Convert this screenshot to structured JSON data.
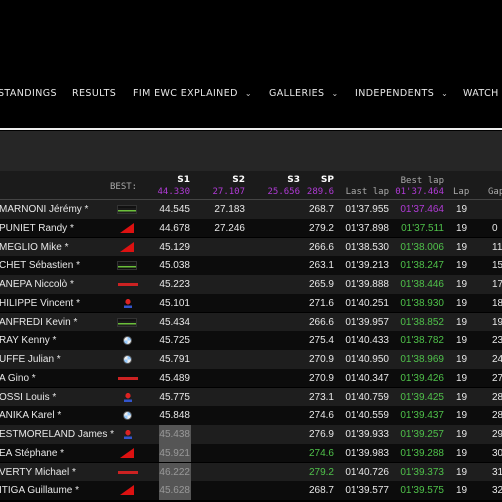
{
  "nav": [
    {
      "label": "STANDINGS",
      "chevron": false
    },
    {
      "label": "RESULTS",
      "chevron": false
    },
    {
      "label": "FIM EWC EXPLAINED",
      "chevron": true
    },
    {
      "label": "GALLERIES",
      "chevron": true
    },
    {
      "label": "INDEPENDENTS",
      "chevron": true
    },
    {
      "label": "WATCH",
      "chevron": false
    }
  ],
  "table": {
    "headers": {
      "best": "BEST:",
      "s1": "S1",
      "s2": "S2",
      "s3": "S3",
      "sp": "SP",
      "last_lap": "Last lap",
      "best_lap": "Best lap",
      "lap": "Lap",
      "gap": "Gap"
    },
    "best": {
      "s1": "44.330",
      "s2": "27.107",
      "s3": "25.656",
      "sp": "289.6",
      "best_lap": "01'37.464"
    },
    "colors": {
      "purple": "#b03ad6",
      "green": "#4fc14a",
      "row_odd": "#1e1e1e",
      "row_even": "#0c0c0c"
    },
    "rows": [
      {
        "name": "MARNONI Jérémy *",
        "brand": "kawasaki",
        "s1": "44.545",
        "s2": "27.183",
        "sp": "268.7",
        "last": "01'37.955",
        "best": "01'37.464",
        "best_color": "purple",
        "lap": "19",
        "gap": ""
      },
      {
        "name": "PUNIET Randy *",
        "brand": "honda",
        "s1": "44.678",
        "s2": "27.246",
        "sp": "279.2",
        "last": "01'37.898",
        "best": "01'37.511",
        "best_color": "green",
        "lap": "19",
        "gap": "0"
      },
      {
        "name": "MEGLIO Mike *",
        "brand": "honda",
        "s1": "45.129",
        "s2": "",
        "sp": "266.6",
        "last": "01'38.530",
        "best": "01'38.006",
        "best_color": "green",
        "lap": "19",
        "gap": "11"
      },
      {
        "name": "CHET Sébastien *",
        "brand": "kawasaki",
        "s1": "45.038",
        "s2": "",
        "sp": "263.1",
        "last": "01'39.213",
        "best": "01'38.247",
        "best_color": "green",
        "lap": "19",
        "gap": "15"
      },
      {
        "name": "ANEPA Niccolò *",
        "brand": "yamaha",
        "s1": "45.223",
        "s2": "",
        "sp": "265.9",
        "last": "01'39.888",
        "best": "01'38.446",
        "best_color": "green",
        "lap": "19",
        "gap": "17"
      },
      {
        "name": "HILIPPE Vincent *",
        "brand": "suzuki",
        "s1": "45.101",
        "s2": "",
        "sp": "271.6",
        "last": "01'40.251",
        "best": "01'38.930",
        "best_color": "green",
        "lap": "19",
        "gap": "18"
      },
      {
        "name": "ANFREDI Kevin *",
        "brand": "kawasaki",
        "s1": "45.434",
        "s2": "",
        "sp": "266.6",
        "last": "01'39.957",
        "best": "01'38.852",
        "best_color": "green",
        "lap": "19",
        "gap": "19"
      },
      {
        "name": "RAY Kenny *",
        "brand": "bmw",
        "s1": "45.725",
        "s2": "",
        "sp": "275.4",
        "last": "01'40.433",
        "best": "01'38.782",
        "best_color": "green",
        "lap": "19",
        "gap": "23"
      },
      {
        "name": "UFFE Julian *",
        "brand": "bmw",
        "s1": "45.791",
        "s2": "",
        "sp": "270.9",
        "last": "01'40.950",
        "best": "01'38.969",
        "best_color": "green",
        "lap": "19",
        "gap": "24"
      },
      {
        "name": "A Gino *",
        "brand": "yamaha",
        "s1": "45.489",
        "s2": "",
        "sp": "270.9",
        "last": "01'40.347",
        "best": "01'39.426",
        "best_color": "green",
        "lap": "19",
        "gap": "27"
      },
      {
        "name": "OSSI Louis *",
        "brand": "suzuki",
        "s1": "45.775",
        "s2": "",
        "sp": "273.1",
        "last": "01'40.759",
        "best": "01'39.425",
        "best_color": "green",
        "lap": "19",
        "gap": "28"
      },
      {
        "name": "ANIKA Karel *",
        "brand": "bmw",
        "s1": "45.848",
        "s2": "",
        "sp": "274.6",
        "last": "01'40.559",
        "best": "01'39.437",
        "best_color": "green",
        "lap": "19",
        "gap": "28"
      },
      {
        "name": "ESTMORELAND James *",
        "brand": "suzuki",
        "s1": "45.438",
        "s1_gray": true,
        "s2": "",
        "sp": "276.9",
        "last": "01'39.933",
        "best": "01'39.257",
        "best_color": "green",
        "lap": "19",
        "gap": "29"
      },
      {
        "name": "EA Stéphane *",
        "brand": "honda",
        "s1": "45.921",
        "s1_gray": true,
        "s2": "",
        "sp": "274.6",
        "sp_green": true,
        "last": "01'39.983",
        "best": "01'39.288",
        "best_color": "green",
        "lap": "19",
        "gap": "30"
      },
      {
        "name": "VERTY Michael *",
        "brand": "yamaha",
        "s1": "46.222",
        "s1_gray": true,
        "s2": "",
        "sp": "279.2",
        "sp_green": true,
        "last": "01'40.726",
        "best": "01'39.373",
        "best_color": "green",
        "lap": "19",
        "gap": "31"
      },
      {
        "name": "ITIGA Guillaume *",
        "brand": "honda",
        "s1": "45.628",
        "s1_gray": true,
        "s2": "",
        "sp": "268.7",
        "last": "01'39.577",
        "best": "01'39.575",
        "best_color": "green",
        "lap": "19",
        "gap": "32"
      }
    ]
  }
}
